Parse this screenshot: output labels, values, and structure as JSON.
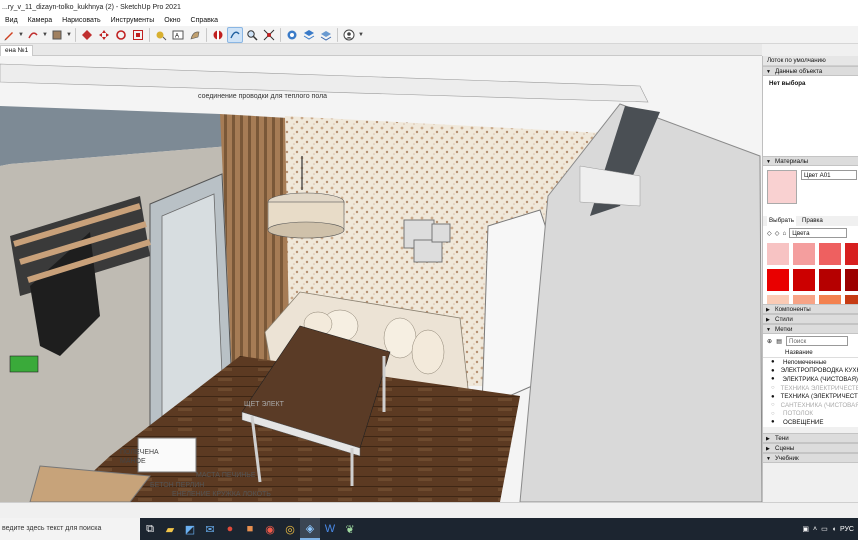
{
  "window": {
    "title": "...ry_v_11_dizayn-tolko_kukhnya (2) - SketchUp Pro 2021"
  },
  "menu": [
    "Вид",
    "Камера",
    "Нарисовать",
    "Инструменты",
    "Окно",
    "Справка"
  ],
  "toolbar": {
    "icons": [
      "pencil-icon",
      "eraser-icon",
      "paint-bucket-icon",
      "push-pull-icon",
      "move-icon",
      "rotate-icon",
      "offset-icon",
      "tape-measure-icon",
      "text-icon",
      "paint-icon",
      "section-plane-icon",
      "orbit-icon",
      "zoom-icon",
      "zoom-extents-icon",
      "warehouse-icon",
      "extension-icon",
      "layers-icon",
      "account-icon"
    ]
  },
  "scene_tab": "ена №1",
  "viewport": {
    "annotations": {
      "top": "соединение проводки для теплого пола",
      "mid": "ЩЕТ ЭЛЕКТ",
      "bottom1": "ПОЛЕЧЕНА",
      "bottom2": "МАНОЕ",
      "bottom3": "МАСТА ПЕЧИНЬЕ",
      "bottom4": "БЕТОН ПЕРЛИН",
      "bottom5": "ЕНЕЛЕНИЕ КРУЖКА ЛОКОТЬ"
    }
  },
  "panel": {
    "tray_title": "Лоток по умолчанию",
    "entity_info": {
      "header": "Данные объекта",
      "value": "Нет выбора"
    },
    "materials": {
      "header": "Материалы",
      "name": "Цвет A01",
      "tab_select": "Выбрать",
      "tab_edit": "Правка",
      "library": "Цвета",
      "swatch_colors": [
        "#f7c3c3",
        "#f49e9e",
        "#ee6060",
        "#d71f1f",
        "#e90000",
        "#cc0000",
        "#b50000",
        "#9c0000",
        "#fbcbb5",
        "#f7a386",
        "#f3814f",
        "#c63b14",
        "#e05a2a",
        "#ff7a3a",
        "#ff5a1a",
        "#c83200"
      ]
    },
    "components": "Компоненты",
    "styles": "Стили",
    "tags": {
      "header": "Метки",
      "search": "Поиск",
      "col_name": "Название",
      "items": [
        {
          "name": "Непомеченные",
          "dim": false
        },
        {
          "name": "ЭЛЕКТРОПРОВОДКА КУХНЯ",
          "dim": false
        },
        {
          "name": "ЭЛЕКТРИКА (ЧИСТОВАЯ)",
          "dim": false
        },
        {
          "name": "ТЕХНИКА ЭЛЕКТРИЧЕСТВО",
          "dim": true
        },
        {
          "name": "ТЕХНИКА (ЭЛЕКТРИЧЕСТВО)",
          "dim": false
        },
        {
          "name": "САНТЕХНИКА (ЧИСТОВАЯ)",
          "dim": true
        },
        {
          "name": "ПОТОЛОК",
          "dim": true
        },
        {
          "name": "ОСВЕЩЕНИЕ",
          "dim": false
        }
      ]
    },
    "shadows": "Тени",
    "scenes": "Сцены",
    "instructor": "Учебник"
  },
  "taskbar": {
    "search_placeholder": "ведите здесь текст для поиска",
    "apps": [
      "task-view-icon",
      "file-explorer-icon",
      "store-icon",
      "mail-icon",
      "red-app-icon",
      "tiles-icon",
      "maps-icon",
      "chrome-icon",
      "sketchup-icon",
      "word-icon",
      "feather-icon"
    ],
    "lang": "РУС"
  }
}
